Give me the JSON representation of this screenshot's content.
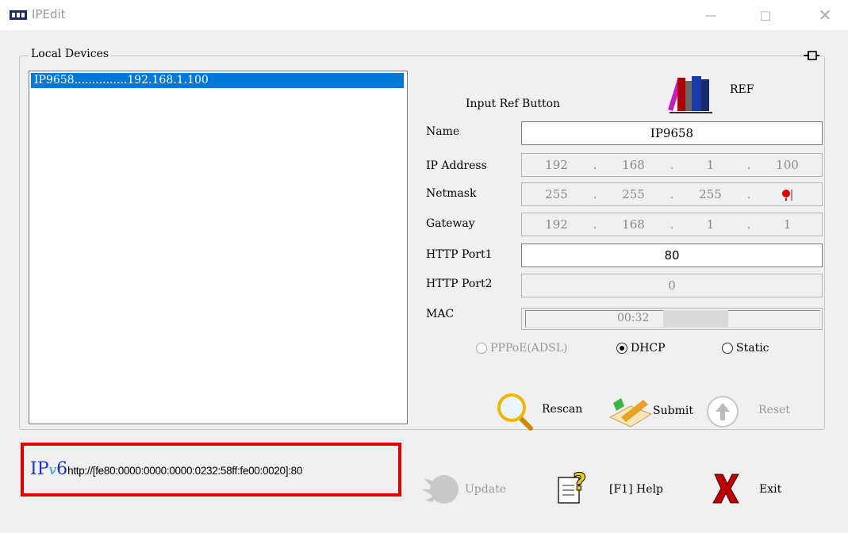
{
  "window": {
    "title": "IPEdit",
    "minimize": "—",
    "maximize": "□",
    "close": "✕"
  },
  "group": {
    "label": "Local Devices",
    "pin": "⊣⊨"
  },
  "devices": [
    {
      "label": "IP9658...............192.168.1.100"
    }
  ],
  "ref": {
    "caption": "Input Ref Button",
    "label": "REF"
  },
  "form": {
    "name_label": "Name",
    "name_value": "IP9658",
    "ip_label": "IP Address",
    "ip": [
      "192",
      "168",
      "1",
      "100"
    ],
    "netmask_label": "Netmask",
    "netmask": [
      "255",
      "255",
      "255",
      ""
    ],
    "gateway_label": "Gateway",
    "gateway": [
      "192",
      "168",
      "1",
      "1"
    ],
    "port1_label": "HTTP Port1",
    "port1_value": "80",
    "port2_label": "HTTP Port2",
    "port2_value": "0",
    "mac_label": "MAC",
    "mac_value": "00:32"
  },
  "modes": [
    {
      "label": "PPPoE(ADSL)",
      "selected": false,
      "enabled": false
    },
    {
      "label": "DHCP",
      "selected": true,
      "enabled": true
    },
    {
      "label": "Static",
      "selected": false,
      "enabled": true
    }
  ],
  "actions": {
    "rescan": "Rescan",
    "submit": "Submit",
    "reset": "Reset"
  },
  "ipv6": {
    "prefix_ip": "IP",
    "prefix_v": "v",
    "prefix_6": "6",
    "url": "http://[fe80:0000:0000:0000:0232:58ff:fe00:0020]:80"
  },
  "bottom": {
    "update": "Update",
    "help": "[F1] Help",
    "exit": "Exit"
  }
}
